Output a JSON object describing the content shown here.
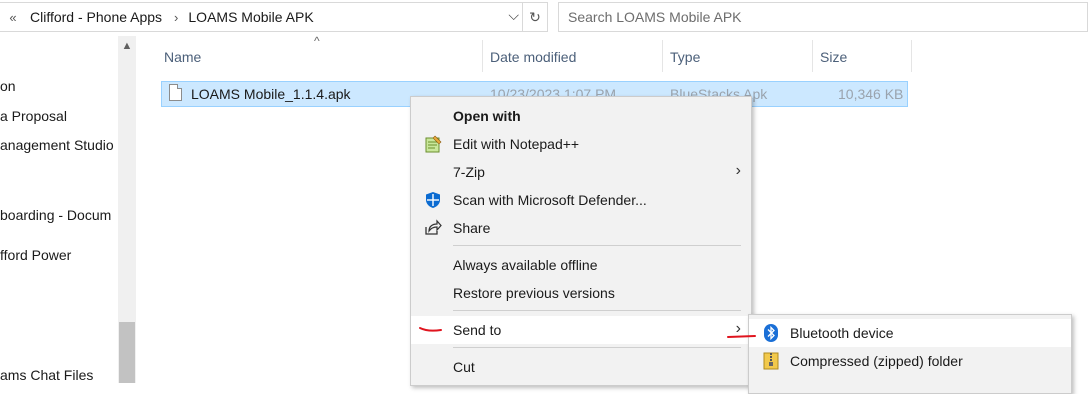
{
  "address_bar": {
    "overflow_chevron": "«",
    "crumbs": [
      "Clifford - Phone Apps",
      "LOAMS Mobile APK"
    ],
    "separator": "›",
    "dropdown": "⌵",
    "refresh": "↻"
  },
  "search": {
    "placeholder": "Search LOAMS Mobile APK"
  },
  "nav": {
    "items": [
      "on",
      "a Proposal",
      "anagement Studio",
      "boarding - Docum",
      "fford Power",
      "ams Chat Files"
    ]
  },
  "scrollbar": {
    "up_arrow": "▲"
  },
  "columns": {
    "sort_indicator": "^",
    "headers": [
      "Name",
      "Date modified",
      "Type",
      "Size"
    ]
  },
  "files": [
    {
      "name": "LOAMS Mobile_1.1.4.apk",
      "date": "10/23/2023 1:07 PM",
      "type": "BlueStacks Apk",
      "size": "10,346 KB"
    }
  ],
  "context_menu": {
    "items": [
      {
        "label": "Open with",
        "bold": true
      },
      {
        "label": "Edit with Notepad++",
        "icon": "notepad-plus-plus-icon"
      },
      {
        "label": "7-Zip",
        "submenu": true
      },
      {
        "label": "Scan with Microsoft Defender...",
        "icon": "defender-shield-icon"
      },
      {
        "label": "Share",
        "icon": "share-icon"
      },
      {
        "label": "Always available offline"
      },
      {
        "label": "Restore previous versions"
      },
      {
        "label": "Send to",
        "submenu": true,
        "highlighted": true
      },
      {
        "label": "Cut"
      }
    ],
    "submenu_arrow": "›"
  },
  "send_to_submenu": {
    "items": [
      {
        "label": "Bluetooth device",
        "icon": "bluetooth-icon",
        "highlighted": true
      },
      {
        "label": "Compressed (zipped) folder",
        "icon": "zip-folder-icon"
      }
    ]
  },
  "colors": {
    "selection_bg": "#cce8ff",
    "selection_border": "#99d1ff",
    "menu_bg": "#f2f2f2",
    "header_text": "#4c607a",
    "annotation_red": "#e0141e",
    "defender_blue": "#0b6bd1",
    "bluetooth_blue": "#1a6fd6"
  }
}
